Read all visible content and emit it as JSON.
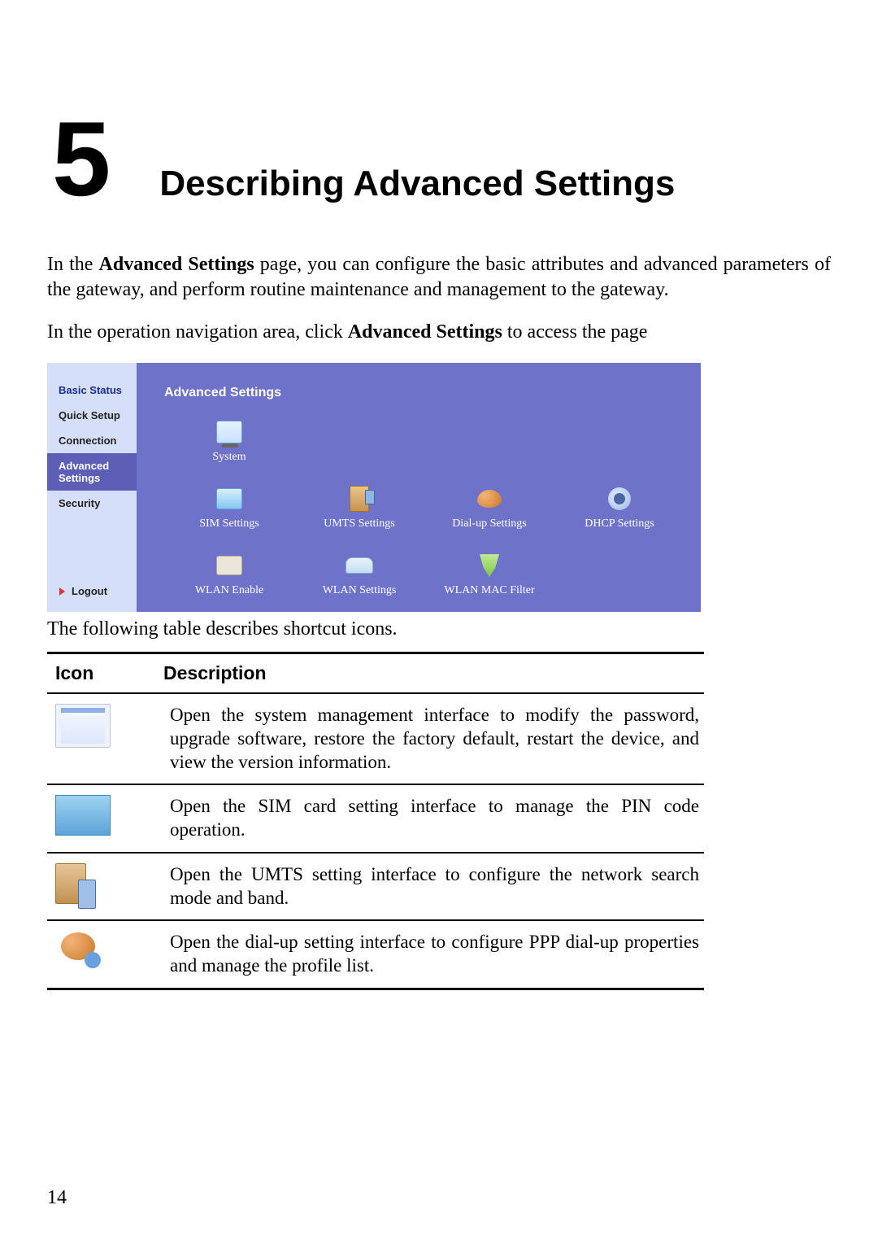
{
  "chapter": {
    "number": "5",
    "title": "Describing Advanced Settings"
  },
  "para1_a": "In the ",
  "para1_b": "Advanced Settings",
  "para1_c": " page, you can configure the basic attributes and advanced parameters of the gateway, and perform routine maintenance and management to the gateway.",
  "para2_a": "In the operation navigation area, click ",
  "para2_b": "Advanced Settings",
  "para2_c": " to access the page",
  "router": {
    "nav": {
      "items": [
        {
          "label": "Basic Status",
          "kind": "bold"
        },
        {
          "label": "Quick Setup",
          "kind": "plain"
        },
        {
          "label": "Connection",
          "kind": "plain"
        },
        {
          "label": "Advanced Settings",
          "kind": "active"
        },
        {
          "label": "Security",
          "kind": "plain"
        }
      ],
      "logout": "Logout"
    },
    "main": {
      "title": "Advanced Settings",
      "row1": [
        {
          "label": "System"
        }
      ],
      "row2": [
        {
          "label": "SIM Settings"
        },
        {
          "label": "UMTS Settings"
        },
        {
          "label": "Dial-up Settings"
        },
        {
          "label": "DHCP Settings"
        }
      ],
      "row3": [
        {
          "label": "WLAN Enable"
        },
        {
          "label": "WLAN Settings"
        },
        {
          "label": "WLAN MAC Filter"
        }
      ]
    }
  },
  "table": {
    "intro": "The following table describes shortcut icons.",
    "headers": {
      "icon": "Icon",
      "desc": "Description"
    },
    "rows": [
      {
        "icon_name": "system-icon",
        "desc": "Open the system management interface to modify the password, upgrade software, restore the factory default, restart the device, and view the version information."
      },
      {
        "icon_name": "sim-icon",
        "desc": "Open the SIM card setting interface to manage the PIN code operation."
      },
      {
        "icon_name": "umts-icon",
        "desc": "Open the UMTS setting interface to configure the network search mode and band."
      },
      {
        "icon_name": "dialup-icon",
        "desc": "Open the dial-up setting interface to configure PPP dial-up properties and manage the profile list."
      }
    ]
  },
  "page_number": "14"
}
